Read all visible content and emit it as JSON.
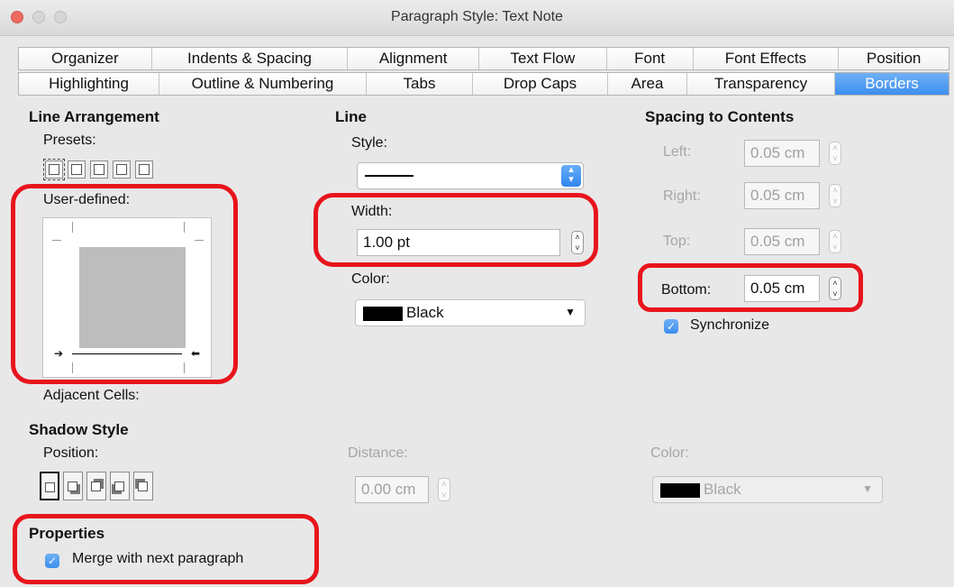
{
  "window": {
    "title": "Paragraph Style: Text Note"
  },
  "tabs": {
    "row1": [
      "Organizer",
      "Indents & Spacing",
      "Alignment",
      "Text Flow",
      "Font",
      "Font Effects",
      "Position"
    ],
    "row2": [
      "Highlighting",
      "Outline & Numbering",
      "Tabs",
      "Drop Caps",
      "Area",
      "Transparency",
      "Borders"
    ],
    "active": "Borders"
  },
  "line_arrangement": {
    "heading": "Line Arrangement",
    "presets_label": "Presets:",
    "user_defined_label": "User-defined:",
    "adjacent_cells_label": "Adjacent Cells:"
  },
  "line": {
    "heading": "Line",
    "style_label": "Style:",
    "width_label": "Width:",
    "width_value": "1.00 pt",
    "color_label": "Color:",
    "color_value": "Black"
  },
  "spacing": {
    "heading": "Spacing to Contents",
    "left_label": "Left:",
    "left_value": "0.05 cm",
    "right_label": "Right:",
    "right_value": "0.05 cm",
    "top_label": "Top:",
    "top_value": "0.05 cm",
    "bottom_label": "Bottom:",
    "bottom_value": "0.05 cm",
    "synchronize_label": "Synchronize",
    "synchronize_checked": true
  },
  "shadow": {
    "heading": "Shadow Style",
    "position_label": "Position:",
    "distance_label": "Distance:",
    "distance_value": "0.00 cm",
    "color_label": "Color:",
    "color_value": "Black"
  },
  "properties": {
    "heading": "Properties",
    "merge_label": "Merge with next paragraph",
    "merge_checked": true
  },
  "colors": {
    "accent": "#3d8fee",
    "highlight": "#e8141c"
  }
}
